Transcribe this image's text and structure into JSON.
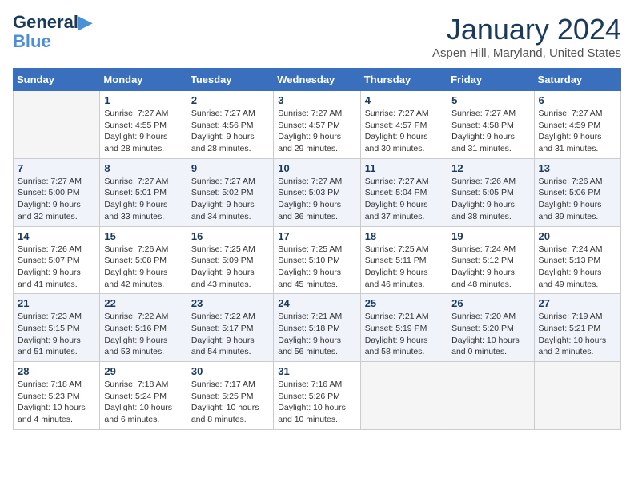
{
  "logo": {
    "line1": "General",
    "line2": "Blue",
    "tagline": ""
  },
  "header": {
    "month": "January 2024",
    "location": "Aspen Hill, Maryland, United States"
  },
  "days_of_week": [
    "Sunday",
    "Monday",
    "Tuesday",
    "Wednesday",
    "Thursday",
    "Friday",
    "Saturday"
  ],
  "weeks": [
    [
      {
        "num": "",
        "sunrise": "",
        "sunset": "",
        "daylight": ""
      },
      {
        "num": "1",
        "sunrise": "Sunrise: 7:27 AM",
        "sunset": "Sunset: 4:55 PM",
        "daylight": "Daylight: 9 hours and 28 minutes."
      },
      {
        "num": "2",
        "sunrise": "Sunrise: 7:27 AM",
        "sunset": "Sunset: 4:56 PM",
        "daylight": "Daylight: 9 hours and 28 minutes."
      },
      {
        "num": "3",
        "sunrise": "Sunrise: 7:27 AM",
        "sunset": "Sunset: 4:57 PM",
        "daylight": "Daylight: 9 hours and 29 minutes."
      },
      {
        "num": "4",
        "sunrise": "Sunrise: 7:27 AM",
        "sunset": "Sunset: 4:57 PM",
        "daylight": "Daylight: 9 hours and 30 minutes."
      },
      {
        "num": "5",
        "sunrise": "Sunrise: 7:27 AM",
        "sunset": "Sunset: 4:58 PM",
        "daylight": "Daylight: 9 hours and 31 minutes."
      },
      {
        "num": "6",
        "sunrise": "Sunrise: 7:27 AM",
        "sunset": "Sunset: 4:59 PM",
        "daylight": "Daylight: 9 hours and 31 minutes."
      }
    ],
    [
      {
        "num": "7",
        "sunrise": "Sunrise: 7:27 AM",
        "sunset": "Sunset: 5:00 PM",
        "daylight": "Daylight: 9 hours and 32 minutes."
      },
      {
        "num": "8",
        "sunrise": "Sunrise: 7:27 AM",
        "sunset": "Sunset: 5:01 PM",
        "daylight": "Daylight: 9 hours and 33 minutes."
      },
      {
        "num": "9",
        "sunrise": "Sunrise: 7:27 AM",
        "sunset": "Sunset: 5:02 PM",
        "daylight": "Daylight: 9 hours and 34 minutes."
      },
      {
        "num": "10",
        "sunrise": "Sunrise: 7:27 AM",
        "sunset": "Sunset: 5:03 PM",
        "daylight": "Daylight: 9 hours and 36 minutes."
      },
      {
        "num": "11",
        "sunrise": "Sunrise: 7:27 AM",
        "sunset": "Sunset: 5:04 PM",
        "daylight": "Daylight: 9 hours and 37 minutes."
      },
      {
        "num": "12",
        "sunrise": "Sunrise: 7:26 AM",
        "sunset": "Sunset: 5:05 PM",
        "daylight": "Daylight: 9 hours and 38 minutes."
      },
      {
        "num": "13",
        "sunrise": "Sunrise: 7:26 AM",
        "sunset": "Sunset: 5:06 PM",
        "daylight": "Daylight: 9 hours and 39 minutes."
      }
    ],
    [
      {
        "num": "14",
        "sunrise": "Sunrise: 7:26 AM",
        "sunset": "Sunset: 5:07 PM",
        "daylight": "Daylight: 9 hours and 41 minutes."
      },
      {
        "num": "15",
        "sunrise": "Sunrise: 7:26 AM",
        "sunset": "Sunset: 5:08 PM",
        "daylight": "Daylight: 9 hours and 42 minutes."
      },
      {
        "num": "16",
        "sunrise": "Sunrise: 7:25 AM",
        "sunset": "Sunset: 5:09 PM",
        "daylight": "Daylight: 9 hours and 43 minutes."
      },
      {
        "num": "17",
        "sunrise": "Sunrise: 7:25 AM",
        "sunset": "Sunset: 5:10 PM",
        "daylight": "Daylight: 9 hours and 45 minutes."
      },
      {
        "num": "18",
        "sunrise": "Sunrise: 7:25 AM",
        "sunset": "Sunset: 5:11 PM",
        "daylight": "Daylight: 9 hours and 46 minutes."
      },
      {
        "num": "19",
        "sunrise": "Sunrise: 7:24 AM",
        "sunset": "Sunset: 5:12 PM",
        "daylight": "Daylight: 9 hours and 48 minutes."
      },
      {
        "num": "20",
        "sunrise": "Sunrise: 7:24 AM",
        "sunset": "Sunset: 5:13 PM",
        "daylight": "Daylight: 9 hours and 49 minutes."
      }
    ],
    [
      {
        "num": "21",
        "sunrise": "Sunrise: 7:23 AM",
        "sunset": "Sunset: 5:15 PM",
        "daylight": "Daylight: 9 hours and 51 minutes."
      },
      {
        "num": "22",
        "sunrise": "Sunrise: 7:22 AM",
        "sunset": "Sunset: 5:16 PM",
        "daylight": "Daylight: 9 hours and 53 minutes."
      },
      {
        "num": "23",
        "sunrise": "Sunrise: 7:22 AM",
        "sunset": "Sunset: 5:17 PM",
        "daylight": "Daylight: 9 hours and 54 minutes."
      },
      {
        "num": "24",
        "sunrise": "Sunrise: 7:21 AM",
        "sunset": "Sunset: 5:18 PM",
        "daylight": "Daylight: 9 hours and 56 minutes."
      },
      {
        "num": "25",
        "sunrise": "Sunrise: 7:21 AM",
        "sunset": "Sunset: 5:19 PM",
        "daylight": "Daylight: 9 hours and 58 minutes."
      },
      {
        "num": "26",
        "sunrise": "Sunrise: 7:20 AM",
        "sunset": "Sunset: 5:20 PM",
        "daylight": "Daylight: 10 hours and 0 minutes."
      },
      {
        "num": "27",
        "sunrise": "Sunrise: 7:19 AM",
        "sunset": "Sunset: 5:21 PM",
        "daylight": "Daylight: 10 hours and 2 minutes."
      }
    ],
    [
      {
        "num": "28",
        "sunrise": "Sunrise: 7:18 AM",
        "sunset": "Sunset: 5:23 PM",
        "daylight": "Daylight: 10 hours and 4 minutes."
      },
      {
        "num": "29",
        "sunrise": "Sunrise: 7:18 AM",
        "sunset": "Sunset: 5:24 PM",
        "daylight": "Daylight: 10 hours and 6 minutes."
      },
      {
        "num": "30",
        "sunrise": "Sunrise: 7:17 AM",
        "sunset": "Sunset: 5:25 PM",
        "daylight": "Daylight: 10 hours and 8 minutes."
      },
      {
        "num": "31",
        "sunrise": "Sunrise: 7:16 AM",
        "sunset": "Sunset: 5:26 PM",
        "daylight": "Daylight: 10 hours and 10 minutes."
      },
      {
        "num": "",
        "sunrise": "",
        "sunset": "",
        "daylight": ""
      },
      {
        "num": "",
        "sunrise": "",
        "sunset": "",
        "daylight": ""
      },
      {
        "num": "",
        "sunrise": "",
        "sunset": "",
        "daylight": ""
      }
    ]
  ]
}
